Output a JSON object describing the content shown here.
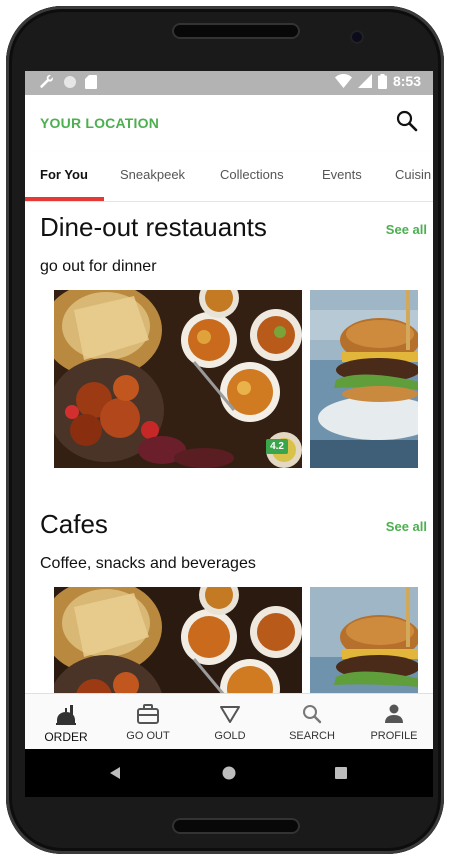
{
  "status_bar": {
    "time": "8:53"
  },
  "header": {
    "location_label": "YOUR LOCATION",
    "search_icon": "search-icon"
  },
  "tabs": [
    {
      "label": "For You",
      "active": true
    },
    {
      "label": "Sneakpeek"
    },
    {
      "label": "Collections"
    },
    {
      "label": "Events"
    },
    {
      "label": "Cuisin"
    }
  ],
  "sections": [
    {
      "title": "Dine-out restauants",
      "see_all": "See all",
      "subtitle": "go out for dinner",
      "rating": "4.2"
    },
    {
      "title": "Cafes",
      "see_all": "See all",
      "subtitle": "Coffee, snacks and beverages"
    }
  ],
  "bottom_nav": [
    {
      "label": "ORDER",
      "icon": "order-icon",
      "active": true
    },
    {
      "label": "GO OUT",
      "icon": "briefcase-icon"
    },
    {
      "label": "GOLD",
      "icon": "gold-triangle-icon"
    },
    {
      "label": "SEARCH",
      "icon": "search-icon"
    },
    {
      "label": "PROFILE",
      "icon": "person-icon"
    }
  ],
  "colors": {
    "accent_green": "#4caf50",
    "tab_indicator": "#e53935",
    "rating_green": "#3aa54a"
  }
}
